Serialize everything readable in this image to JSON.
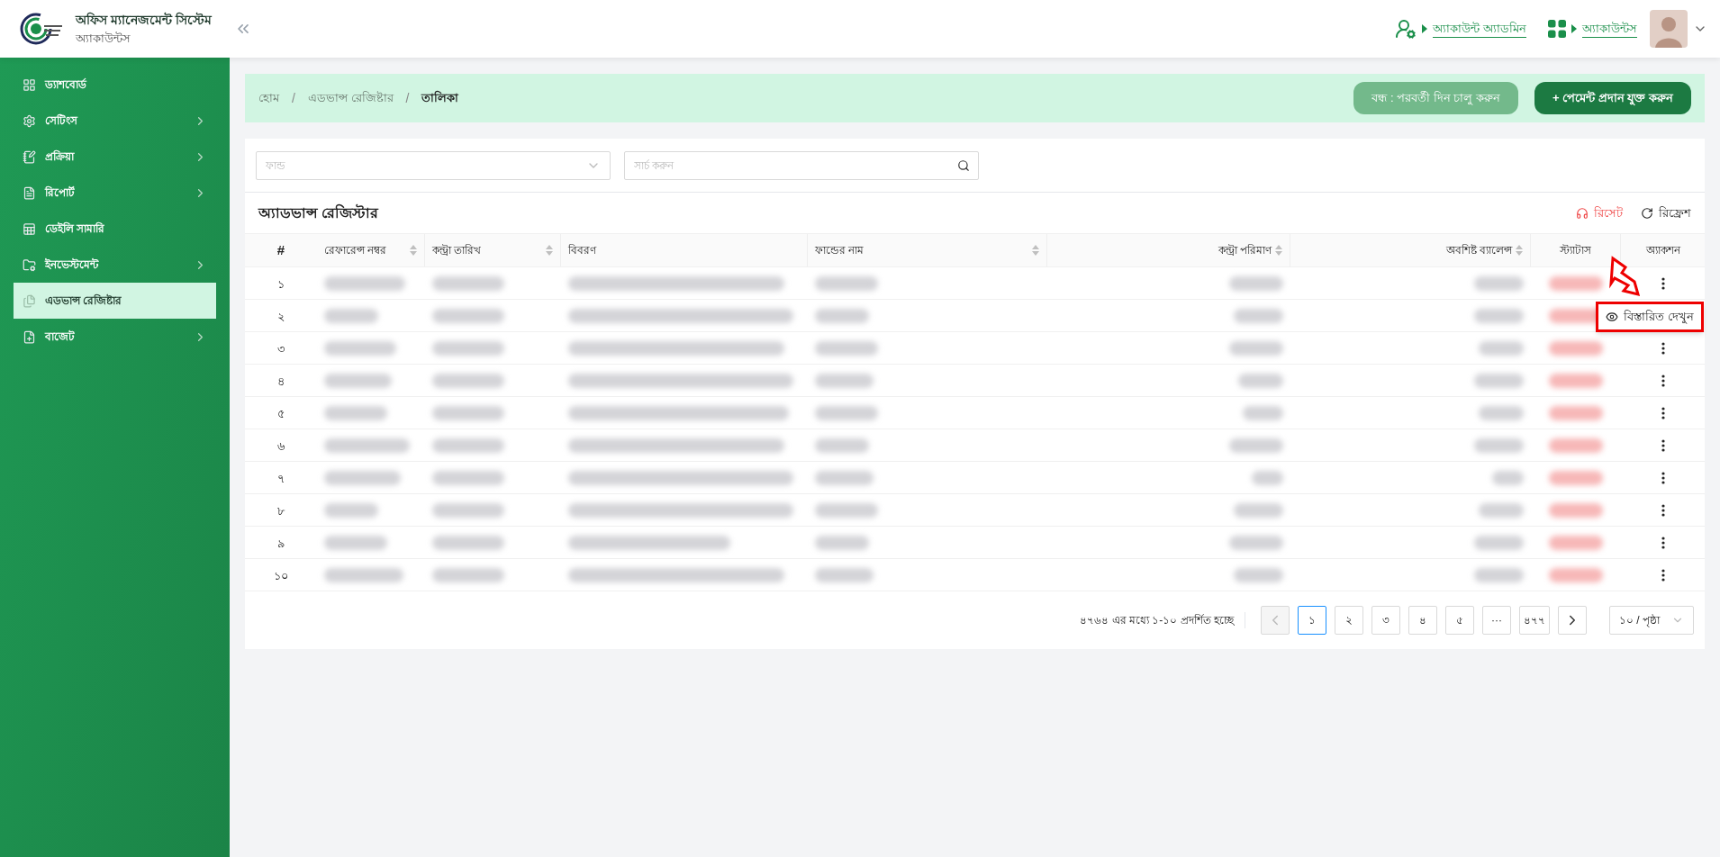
{
  "header": {
    "app_title": "অফিস ম্যানেজমেন্ট সিস্টেম",
    "app_subtitle": "অ্যাকাউন্টস",
    "role_link": "অ্যাকাউন্ট অ্যাডমিন",
    "module_link": "অ্যাকাউন্টস"
  },
  "sidebar": {
    "items": [
      {
        "label": "ড্যাশবোর্ড",
        "has_children": false,
        "selected": false
      },
      {
        "label": "সেটিংস",
        "has_children": true,
        "selected": false
      },
      {
        "label": "প্রক্রিয়া",
        "has_children": true,
        "selected": false
      },
      {
        "label": "রিপোর্ট",
        "has_children": true,
        "selected": false
      },
      {
        "label": "ডেইলি সামারি",
        "has_children": false,
        "selected": false
      },
      {
        "label": "ইনভেস্টমেন্ট",
        "has_children": true,
        "selected": false
      },
      {
        "label": "এডভান্স রেজিষ্টার",
        "has_children": false,
        "selected": true
      },
      {
        "label": "বাজেট",
        "has_children": true,
        "selected": false
      }
    ]
  },
  "breadcrumb": [
    {
      "kind": "link",
      "label": "হোম"
    },
    {
      "kind": "separator",
      "label": "/"
    },
    {
      "kind": "link",
      "label": "এডভান্স রেজিষ্টার"
    },
    {
      "kind": "separator",
      "label": "/"
    },
    {
      "kind": "current",
      "label": "তালিকা"
    }
  ],
  "actions": [
    {
      "label": "বন্ধ : পরবর্তী দিন চালু করুন",
      "disabled": true
    },
    {
      "label": "+ পেমেন্ট প্রদান যুক্ত করুন",
      "disabled": false
    }
  ],
  "filters": {
    "fund_placeholder": "ফান্ড",
    "search_placeholder": "সার্চ করুন"
  },
  "table": {
    "title": "অ্যাডভান্স রেজিস্টার",
    "reset": "রিসেট",
    "refresh": "রিফ্রেশ",
    "columns": [
      {
        "label": "#",
        "sortable": false
      },
      {
        "label": "রেফারেন্স নম্বর",
        "sortable": true
      },
      {
        "label": "কন্ট্রা তারিখ",
        "sortable": true
      },
      {
        "label": "বিবরণ",
        "sortable": false
      },
      {
        "label": "ফান্ডের নাম",
        "sortable": true
      },
      {
        "label": "কন্ট্রা পরিমাণ",
        "sortable": true
      },
      {
        "label": "অবশিষ্ট ব্যালেন্স",
        "sortable": true
      },
      {
        "label": "স্ট্যাটাস",
        "sortable": false
      },
      {
        "label": "অ্যাকশন",
        "sortable": false
      }
    ],
    "rows": [
      {
        "no": "১",
        "menu_open": false
      },
      {
        "no": "২",
        "menu_open": true
      },
      {
        "no": "৩",
        "menu_open": false
      },
      {
        "no": "৪",
        "menu_open": false
      },
      {
        "no": "৫",
        "menu_open": false
      },
      {
        "no": "৬",
        "menu_open": false
      },
      {
        "no": "৭",
        "menu_open": false
      },
      {
        "no": "৮",
        "menu_open": false
      },
      {
        "no": "৯",
        "menu_open": false
      },
      {
        "no": "১০",
        "menu_open": false
      }
    ],
    "row_menu": {
      "label": "বিস্তারিত দেখুন"
    }
  },
  "pagination": {
    "summary": "৪৭৬৪ এর মধ্যে ১-১০ প্রদর্শিত হচ্ছে",
    "pages": [
      {
        "label": "১",
        "selected": true
      },
      {
        "label": "২",
        "selected": false
      },
      {
        "label": "৩",
        "selected": false
      },
      {
        "label": "৪",
        "selected": false
      },
      {
        "label": "৫",
        "selected": false
      },
      {
        "label": "···",
        "selected": false
      },
      {
        "label": "৪৭৭",
        "selected": false
      }
    ],
    "prev_disabled": true,
    "next_disabled": false,
    "page_size": "১০ / পৃষ্ঠা"
  }
}
